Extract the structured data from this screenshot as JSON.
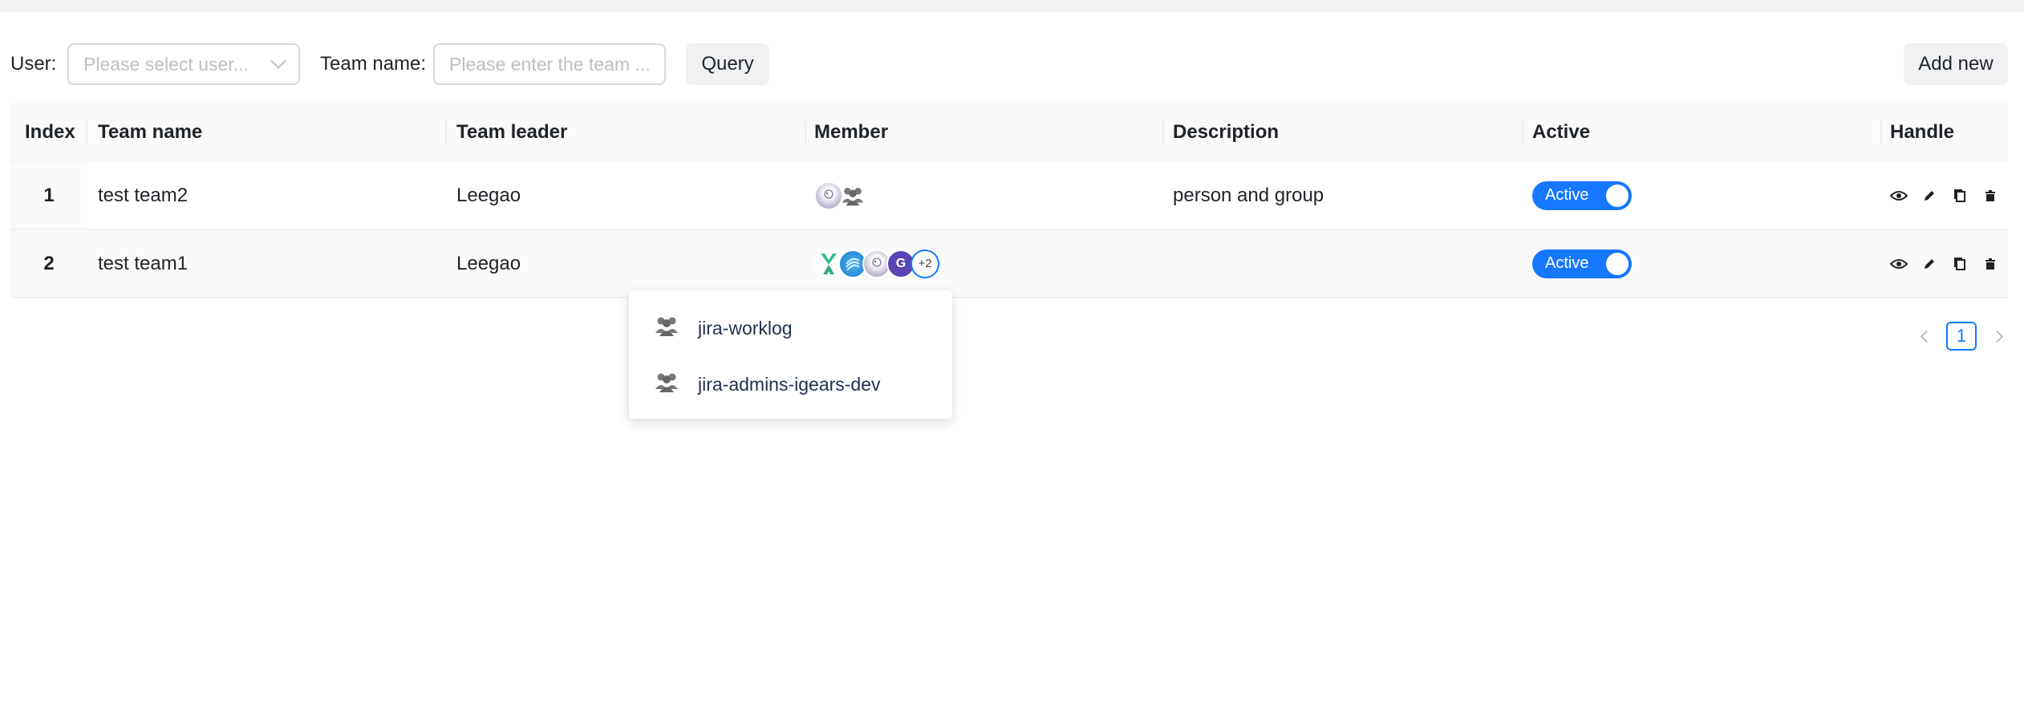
{
  "filter": {
    "user_label": "User",
    "user_placeholder": "Please select user...",
    "team_label": "Team name",
    "team_placeholder": "Please enter the team ...",
    "query_label": "Query",
    "add_label": "Add new"
  },
  "table": {
    "columns": [
      "Index",
      "Team name",
      "Team leader",
      "Member",
      "Description",
      "Active",
      "Handle"
    ],
    "rows": [
      {
        "index": "1",
        "team_name": "test team2",
        "leader": "Leegao",
        "description": "person and group",
        "active": "Active"
      },
      {
        "index": "2",
        "team_name": "test team1",
        "leader": "Leegao",
        "description": "",
        "active": "Active",
        "more_count": "+2",
        "avatar_letter": "G"
      }
    ]
  },
  "pagination": {
    "current": "1"
  },
  "popover": {
    "items": [
      {
        "label": "jira-worklog",
        "icon": "group-icon"
      },
      {
        "label": "jira-admins-igears-dev",
        "icon": "group-icon"
      }
    ]
  },
  "colors": {
    "primary": "#1677ff",
    "avatar_g": "#5b45b5"
  }
}
